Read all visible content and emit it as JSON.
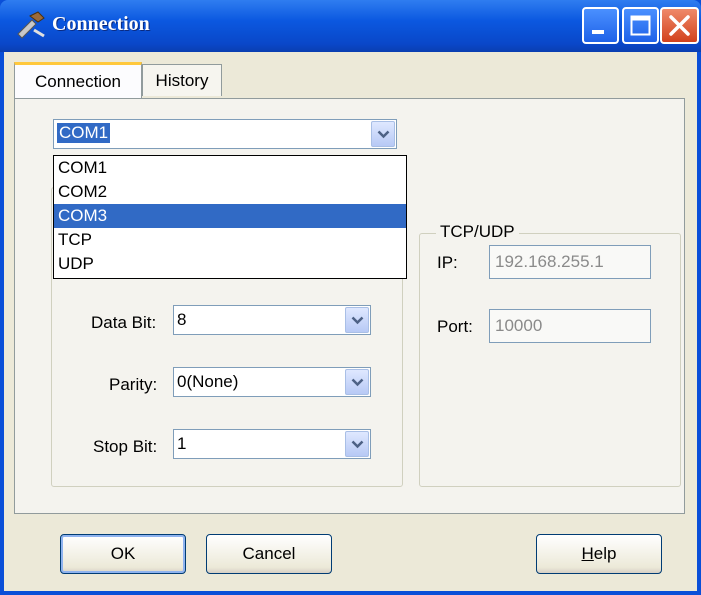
{
  "window": {
    "title": "Connection",
    "app_icon": "tools-icon"
  },
  "titlebar_buttons": {
    "minimize": "minimize-icon",
    "maximize": "maximize-icon",
    "close": "close-icon"
  },
  "tabs": [
    {
      "label": "Connection",
      "active": true
    },
    {
      "label": "History",
      "active": false
    }
  ],
  "connection": {
    "port_combo": {
      "value": "COM1"
    },
    "dropdown_options": [
      "COM1",
      "COM2",
      "COM3",
      "TCP",
      "UDP"
    ],
    "dropdown_highlighted": "COM3",
    "data_bit": {
      "label": "Data Bit:",
      "value": "8"
    },
    "parity": {
      "label": "Parity:",
      "value": "0(None)"
    },
    "stop_bit": {
      "label": "Stop Bit:",
      "value": "1"
    }
  },
  "tcp_udp": {
    "title": "TCP/UDP",
    "ip": {
      "label": "IP:",
      "value": "192.168.255.1"
    },
    "port": {
      "label": "Port:",
      "value": "10000"
    }
  },
  "buttons": {
    "ok": "OK",
    "cancel": "Cancel",
    "help_prefix": "",
    "help_mnemonic": "H",
    "help_rest": "elp"
  },
  "colors": {
    "titlebar": "#0a58e0",
    "selection": "#316ac5",
    "dialog_bg": "#ece9d8",
    "close_button": "#d2411c"
  }
}
